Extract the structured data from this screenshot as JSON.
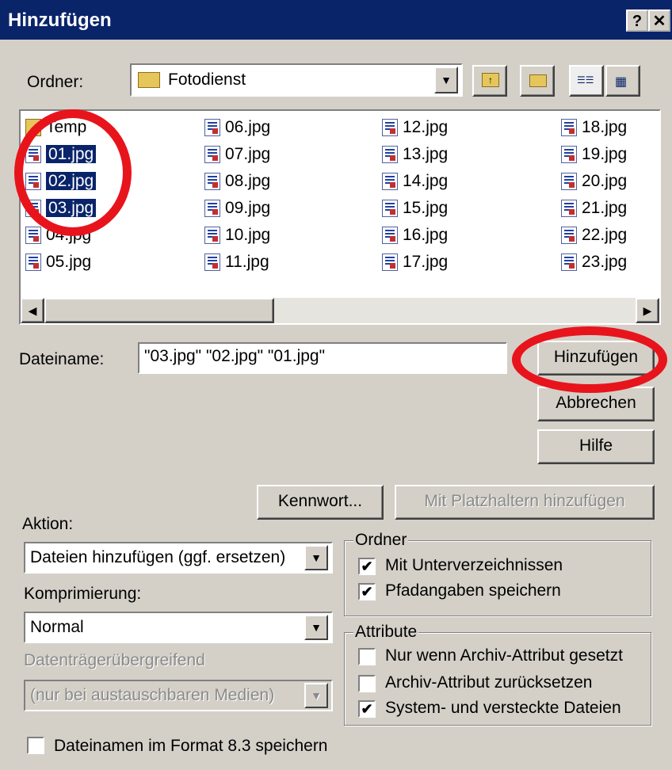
{
  "window": {
    "title": "Hinzufügen",
    "help_label": "?",
    "close_label": "✕"
  },
  "folder": {
    "label": "Ordner:",
    "value": "Fotodienst"
  },
  "files": [
    {
      "name": "Temp",
      "type": "folder",
      "selected": false
    },
    {
      "name": "01.jpg",
      "selected": true
    },
    {
      "name": "02.jpg",
      "selected": true
    },
    {
      "name": "03.jpg",
      "selected": true
    },
    {
      "name": "04.jpg",
      "selected": false
    },
    {
      "name": "05.jpg",
      "selected": false
    },
    {
      "name": "06.jpg",
      "selected": false
    },
    {
      "name": "07.jpg",
      "selected": false
    },
    {
      "name": "08.jpg",
      "selected": false
    },
    {
      "name": "09.jpg",
      "selected": false
    },
    {
      "name": "10.jpg",
      "selected": false
    },
    {
      "name": "11.jpg",
      "selected": false
    },
    {
      "name": "12.jpg",
      "selected": false
    },
    {
      "name": "13.jpg",
      "selected": false
    },
    {
      "name": "14.jpg",
      "selected": false
    },
    {
      "name": "15.jpg",
      "selected": false
    },
    {
      "name": "16.jpg",
      "selected": false
    },
    {
      "name": "17.jpg",
      "selected": false
    },
    {
      "name": "18.jpg",
      "selected": false
    },
    {
      "name": "19.jpg",
      "selected": false
    },
    {
      "name": "20.jpg",
      "selected": false
    },
    {
      "name": "21.jpg",
      "selected": false
    },
    {
      "name": "22.jpg",
      "selected": false
    },
    {
      "name": "23.jpg",
      "selected": false
    }
  ],
  "filename": {
    "label": "Dateiname:",
    "value": "\"03.jpg\" \"02.jpg\" \"01.jpg\""
  },
  "buttons": {
    "add": "Hinzufügen",
    "cancel": "Abbrechen",
    "help": "Hilfe",
    "password": "Kennwort...",
    "add_placeholders": "Mit Platzhaltern hinzufügen"
  },
  "action": {
    "label": "Aktion:",
    "value": "Dateien hinzufügen (ggf. ersetzen)"
  },
  "compression": {
    "label": "Komprimierung:",
    "value": "Normal"
  },
  "span": {
    "label": "Datenträgerübergreifend",
    "value": "(nur bei austauschbaren Medien)"
  },
  "folder_group": {
    "title": "Ordner",
    "options": [
      {
        "label": "Mit Unterverzeichnissen",
        "checked": true
      },
      {
        "label": "Pfadangaben speichern",
        "checked": true
      }
    ]
  },
  "attributes_group": {
    "title": "Attribute",
    "options": [
      {
        "label": "Nur wenn Archiv-Attribut gesetzt",
        "checked": false
      },
      {
        "label": "Archiv-Attribut zurücksetzen",
        "checked": false
      },
      {
        "label": "System- und versteckte Dateien",
        "checked": true
      }
    ]
  },
  "format83": {
    "label": "Dateinamen im Format 8.3 speichern",
    "checked": false
  },
  "colors": {
    "annotation": "#e8141c",
    "titlebar": "#0a246a",
    "selection": "#0a246a"
  }
}
